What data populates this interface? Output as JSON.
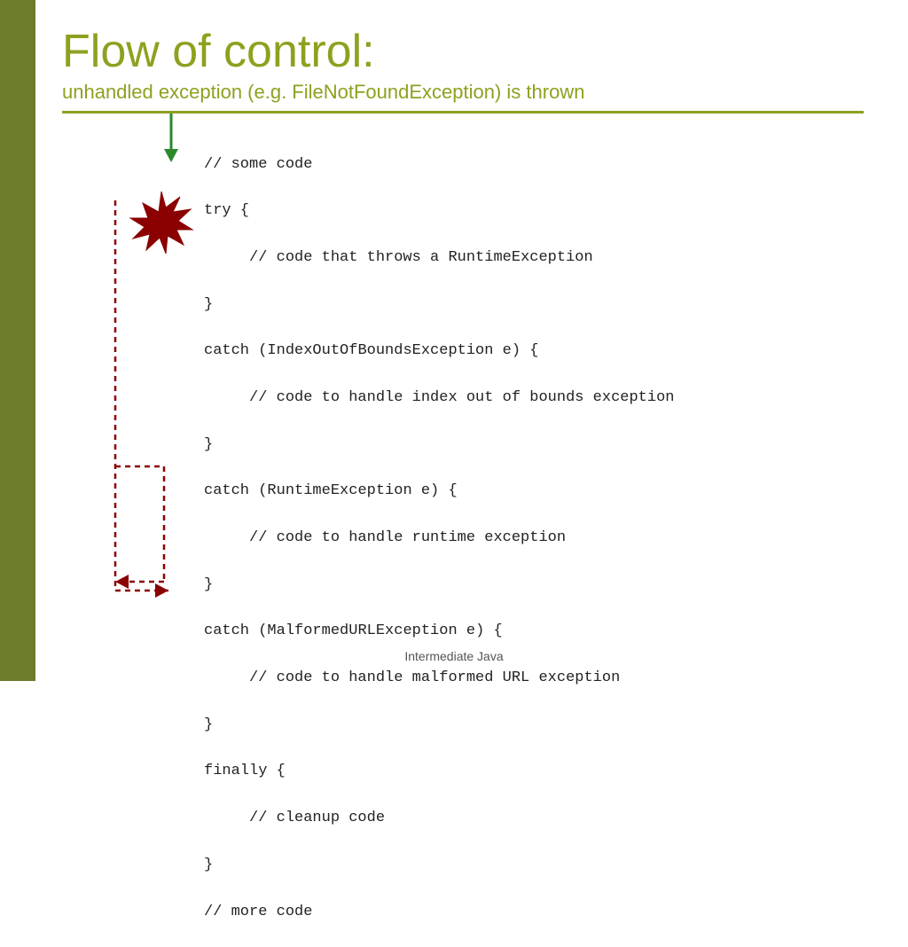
{
  "title": "Flow of control:",
  "subtitle": "unhandled exception (e.g. FileNotFoundException) is thrown",
  "code_lines": [
    "// some code",
    "try {",
    "     // code that throws a RuntimeException",
    "}",
    "catch (IndexOutOfBoundsException e) {",
    "     // code to handle index out of bounds exception",
    "}",
    "catch (RuntimeException e) {",
    "     // code to handle runtime exception",
    "}",
    "catch (MalformedURLException e) {",
    "     // code to handle malformed URL exception",
    "}",
    "finally {",
    "     // cleanup code",
    "}",
    "// more code"
  ],
  "footer": "Intermediate Java",
  "colors": {
    "title": "#8fa020",
    "sidebar": "#6b7c2a",
    "code_text": "#222222",
    "arrow_green": "#2a8a2a",
    "arrow_red": "#8b0000",
    "explosion": "#8b0000"
  }
}
